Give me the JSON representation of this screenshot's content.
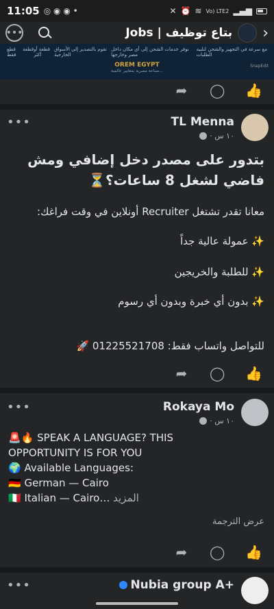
{
  "status": {
    "time": "11:05",
    "carrier": "Vo) LTE2"
  },
  "header": {
    "title": "بتاع توظيف | Jobs"
  },
  "banner": {
    "items": [
      "قطع فقط",
      "قطعة",
      "قطعة أو أكثر",
      "تقوم بالتصدير إلى الأسواق الخارجية",
      "نوفر خدمات الشحن إلى أي مكان داخل مصر وخارجها",
      "مع سرعة في التجهيز والشحن لتلبية الطلبات"
    ],
    "brand": "OREM EGYPT",
    "tagline": "صناعة مصرية بمعايير عالمية...",
    "watermark": "SnapEdit"
  },
  "post1": {
    "author": "TL Menna",
    "time": "١٠ س ·",
    "headline": "بتدور على مصدر دخل إضافي ومش فاضي لشغل 8 ساعات؟⏳",
    "lines": [
      "معانا تقدر تشتغل Recruiter أونلاين في وقت فراغك:",
      "✨ عمولة عالية جداً",
      "✨ للطلبة والخريجين",
      "✨ بدون أي خبرة وبدون أي رسوم",
      "للتواصل واتساب فقط: 01225521708 🚀"
    ]
  },
  "post2": {
    "author": "Rokaya Mo",
    "time": "١٠ س ·",
    "lines": [
      "🚨🔥 SPEAK A LANGUAGE? THIS",
      "OPPORTUNITY IS FOR YOU",
      "🌍 Available Languages:",
      "🇩🇪 German — Cairo",
      "🇮🇹 Italian — Cairo…"
    ],
    "see_more": "المزيد",
    "translate": "عرض الترجمة"
  },
  "post3": {
    "author": "Nubia group A+"
  },
  "icons": {
    "like": "like-icon",
    "comment": "comment-icon",
    "share": "share-icon"
  }
}
